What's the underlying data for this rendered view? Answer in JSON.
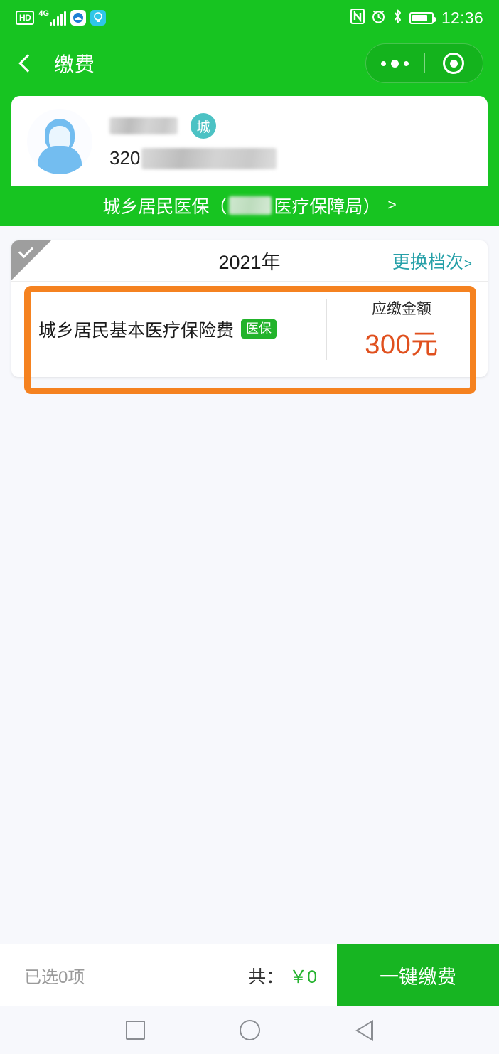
{
  "status_bar": {
    "hd_label": "HD",
    "network_label": "4G",
    "time": "12:36",
    "icons": [
      "hd-icon",
      "signal-bars-icon",
      "app-icon",
      "flashlight-icon",
      "nfc-icon",
      "alarm-icon",
      "bluetooth-icon",
      "battery-icon"
    ]
  },
  "nav": {
    "back_icon": "back-chevron-icon",
    "title": "缴费",
    "capsule": {
      "menu_icon": "more-dots-icon",
      "close_icon": "target-circle-icon"
    }
  },
  "user_card": {
    "avatar_icon": "person-avatar-icon",
    "name_redacted": "",
    "city_badge": "城",
    "id_prefix": "320",
    "id_redacted": ""
  },
  "insurance_strip": {
    "prefix": "城乡居民医保（",
    "org_redacted": "",
    "suffix": "医疗保障局）",
    "arrow": ">"
  },
  "payment_card": {
    "checkmark_icon": "corner-check-icon",
    "selected": false,
    "year": "2021年",
    "change_tier_label": "更换档次",
    "change_tier_arrow": ">",
    "item": {
      "title": "城乡居民基本医疗保险费",
      "tag": "医保",
      "amount_label": "应缴金额",
      "amount_value": "300元"
    }
  },
  "annotation": {
    "highlight_color": "#f58220"
  },
  "bottom_bar": {
    "selected_text": "已选0项",
    "total_label": "共：",
    "total_value": "￥0",
    "pay_button": "一键缴费"
  },
  "android_nav": {
    "recents_icon": "square-recents-icon",
    "home_icon": "circle-home-icon",
    "back_icon": "triangle-back-icon"
  },
  "colors": {
    "brand_green": "#17c421",
    "amount_orange": "#e0501e",
    "link_teal": "#26a0a8",
    "highlight_orange": "#f58220"
  }
}
